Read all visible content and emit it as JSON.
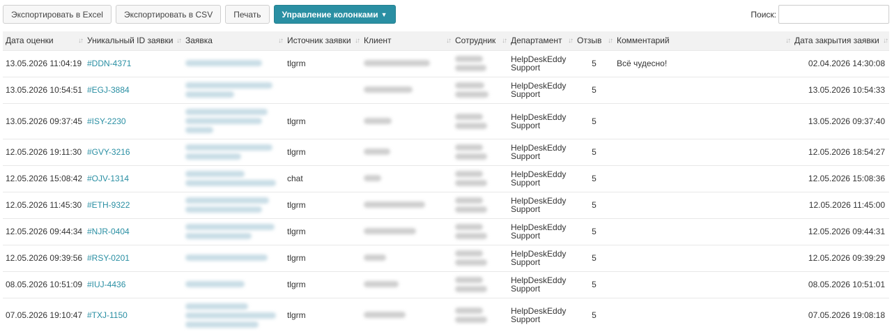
{
  "toolbar": {
    "export_excel": "Экспортировать в Excel",
    "export_csv": "Экспортировать в CSV",
    "print": "Печать",
    "columns": "Управление колонками"
  },
  "search": {
    "label": "Поиск:",
    "value": ""
  },
  "columns": [
    "Дата оценки",
    "Уникальный ID заявки",
    "Заявка",
    "Источник заявки",
    "Клиент",
    "Сотрудник",
    "Департамент",
    "Отзыв",
    "Комментарий",
    "Дата закрытия заявки"
  ],
  "rows": [
    {
      "rated": "13.05.2026 11:04:19",
      "id": "#DDN-4371",
      "source": "tlgrm",
      "dept": "HelpDeskEddy Support",
      "rating": "5",
      "comment": "Всё чудесно!",
      "closed": "02.04.2026 14:30:08"
    },
    {
      "rated": "13.05.2026 10:54:51",
      "id": "#EGJ-3884",
      "source": "",
      "dept": "HelpDeskEddy Support",
      "rating": "5",
      "comment": "",
      "closed": "13.05.2026 10:54:33"
    },
    {
      "rated": "13.05.2026 09:37:45",
      "id": "#ISY-2230",
      "source": "tlgrm",
      "dept": "HelpDeskEddy Support",
      "rating": "5",
      "comment": "",
      "closed": "13.05.2026 09:37:40"
    },
    {
      "rated": "12.05.2026 19:11:30",
      "id": "#GVY-3216",
      "source": "tlgrm",
      "dept": "HelpDeskEddy Support",
      "rating": "5",
      "comment": "",
      "closed": "12.05.2026 18:54:27"
    },
    {
      "rated": "12.05.2026 15:08:42",
      "id": "#OJV-1314",
      "source": "chat",
      "dept": "HelpDeskEddy Support",
      "rating": "5",
      "comment": "",
      "closed": "12.05.2026 15:08:36"
    },
    {
      "rated": "12.05.2026 11:45:30",
      "id": "#ETH-9322",
      "source": "tlgrm",
      "dept": "HelpDeskEddy Support",
      "rating": "5",
      "comment": "",
      "closed": "12.05.2026 11:45:00"
    },
    {
      "rated": "12.05.2026 09:44:34",
      "id": "#NJR-0404",
      "source": "tlgrm",
      "dept": "HelpDeskEddy Support",
      "rating": "5",
      "comment": "",
      "closed": "12.05.2026 09:44:31"
    },
    {
      "rated": "12.05.2026 09:39:56",
      "id": "#RSY-0201",
      "source": "tlgrm",
      "dept": "HelpDeskEddy Support",
      "rating": "5",
      "comment": "",
      "closed": "12.05.2026 09:39:29"
    },
    {
      "rated": "08.05.2026 10:51:09",
      "id": "#IUJ-4436",
      "source": "tlgrm",
      "dept": "HelpDeskEddy Support",
      "rating": "5",
      "comment": "",
      "closed": "08.05.2026 10:51:01"
    },
    {
      "rated": "07.05.2026 19:10:47",
      "id": "#TXJ-1150",
      "source": "tlgrm",
      "dept": "HelpDeskEddy Support",
      "rating": "5",
      "comment": "",
      "closed": "07.05.2026 19:08:18"
    }
  ],
  "colors": {
    "accent": "#2a8fa3",
    "header_bg": "#f2f2f2"
  }
}
